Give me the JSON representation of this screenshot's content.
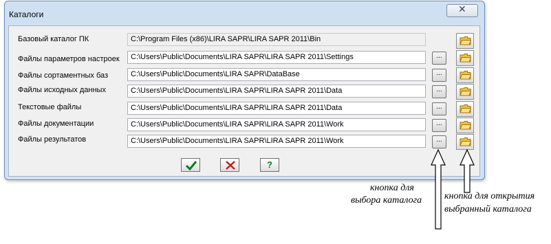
{
  "window": {
    "title": "Каталоги",
    "close_glyph": "✕"
  },
  "rows": [
    {
      "label": "Базовый каталог ПК",
      "path": "C:\\Program Files (x86)\\LIRA SAPR\\LIRA SAPR 2011\\Bin",
      "readonly": true
    },
    {
      "label": "Файлы параметров настроек",
      "path": "C:\\Users\\Public\\Documents\\LIRA SAPR\\LIRA SAPR 2011\\Settings",
      "readonly": false
    },
    {
      "label": "Файлы сортаментных баз",
      "path": "C:\\Users\\Public\\Documents\\LIRA SAPR\\DataBase",
      "readonly": false
    },
    {
      "label": "Файлы исходных данных",
      "path": "C:\\Users\\Public\\Documents\\LIRA SAPR\\LIRA SAPR 2011\\Data",
      "readonly": false
    },
    {
      "label": "Текстовые файлы",
      "path": "C:\\Users\\Public\\Documents\\LIRA SAPR\\LIRA SAPR 2011\\Data",
      "readonly": false
    },
    {
      "label": "Файлы документации",
      "path": "C:\\Users\\Public\\Documents\\LIRA SAPR\\LIRA SAPR 2011\\Work",
      "readonly": false
    },
    {
      "label": "Файлы результатов",
      "path": "C:\\Users\\Public\\Documents\\LIRA SAPR\\LIRA SAPR 2011\\Work",
      "readonly": false
    }
  ],
  "browse_button_label": "...",
  "buttons": {
    "ok_icon": "check-icon",
    "cancel_icon": "cross-icon",
    "help_label": "?"
  },
  "annotations": {
    "browse_line1": "кнопка для",
    "browse_line2": "выбора каталога",
    "open_line1": "кнопка для открытия",
    "open_line2": "выбранный каталога"
  },
  "colors": {
    "ok_green": "#0a7d1d",
    "cancel_red": "#c0201a",
    "folder_yellow": "#f2c23a"
  }
}
